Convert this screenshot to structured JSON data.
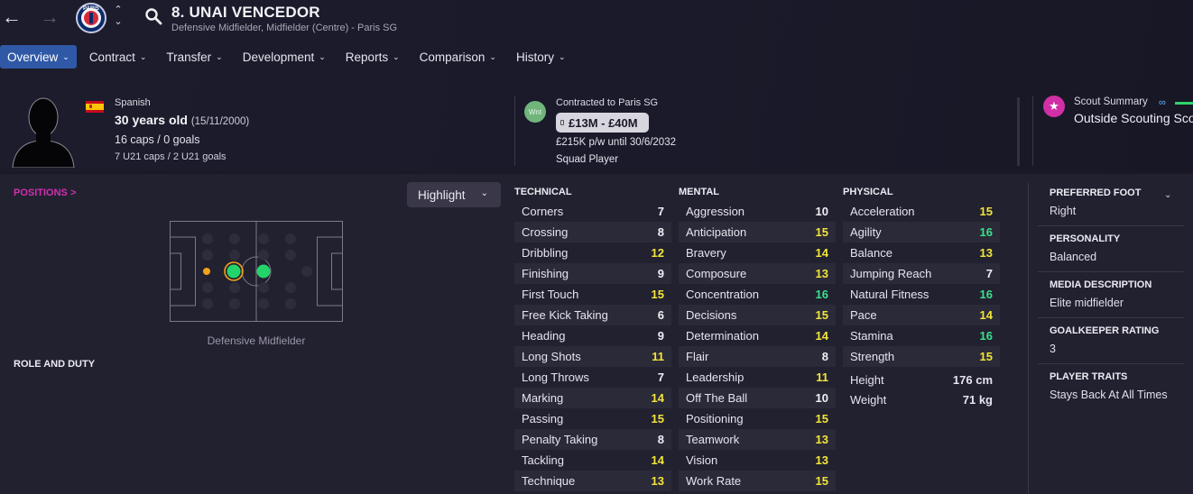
{
  "header": {
    "player_title": "8. UNAI VENCEDOR",
    "player_subtitle": "Defensive Midfielder, Midfielder (Centre) - Paris SG",
    "club_badge_text": "PARIS"
  },
  "tabs": [
    {
      "label": "Overview",
      "active": true
    },
    {
      "label": "Contract"
    },
    {
      "label": "Transfer"
    },
    {
      "label": "Development"
    },
    {
      "label": "Reports"
    },
    {
      "label": "Comparison"
    },
    {
      "label": "History"
    }
  ],
  "profile": {
    "nationality": "Spanish",
    "age": "30 years old",
    "dob": "(15/11/2000)",
    "caps": "16 caps / 0 goals",
    "u21": "7 U21 caps / 2 U21 goals"
  },
  "contract": {
    "status_badge": "Wnt",
    "label": "Contracted to Paris SG",
    "value": "£13M - £40M",
    "wage": "£215K p/w until 30/6/2032",
    "squad_status": "Squad Player"
  },
  "scout": {
    "label": "Scout Summary",
    "value": "Outside Scouting Scope"
  },
  "positions": {
    "title": "POSITIONS >",
    "highlight_label": "Highlight",
    "pitch_label": "Defensive Midfielder",
    "role_title": "ROLE AND DUTY"
  },
  "attributes": {
    "technical": {
      "title": "TECHNICAL",
      "rows": [
        {
          "name": "Corners",
          "value": "7",
          "tier": "white"
        },
        {
          "name": "Crossing",
          "value": "8",
          "tier": "white"
        },
        {
          "name": "Dribbling",
          "value": "12",
          "tier": "yellow"
        },
        {
          "name": "Finishing",
          "value": "9",
          "tier": "white"
        },
        {
          "name": "First Touch",
          "value": "15",
          "tier": "yellow"
        },
        {
          "name": "Free Kick Taking",
          "value": "6",
          "tier": "white"
        },
        {
          "name": "Heading",
          "value": "9",
          "tier": "white"
        },
        {
          "name": "Long Shots",
          "value": "11",
          "tier": "yellow"
        },
        {
          "name": "Long Throws",
          "value": "7",
          "tier": "white"
        },
        {
          "name": "Marking",
          "value": "14",
          "tier": "yellow"
        },
        {
          "name": "Passing",
          "value": "15",
          "tier": "yellow"
        },
        {
          "name": "Penalty Taking",
          "value": "8",
          "tier": "white"
        },
        {
          "name": "Tackling",
          "value": "14",
          "tier": "yellow"
        },
        {
          "name": "Technique",
          "value": "13",
          "tier": "yellow"
        }
      ]
    },
    "mental": {
      "title": "MENTAL",
      "rows": [
        {
          "name": "Aggression",
          "value": "10",
          "tier": "white"
        },
        {
          "name": "Anticipation",
          "value": "15",
          "tier": "yellow"
        },
        {
          "name": "Bravery",
          "value": "14",
          "tier": "yellow"
        },
        {
          "name": "Composure",
          "value": "13",
          "tier": "yellow"
        },
        {
          "name": "Concentration",
          "value": "16",
          "tier": "green"
        },
        {
          "name": "Decisions",
          "value": "15",
          "tier": "yellow"
        },
        {
          "name": "Determination",
          "value": "14",
          "tier": "yellow"
        },
        {
          "name": "Flair",
          "value": "8",
          "tier": "white"
        },
        {
          "name": "Leadership",
          "value": "11",
          "tier": "yellow"
        },
        {
          "name": "Off The Ball",
          "value": "10",
          "tier": "white"
        },
        {
          "name": "Positioning",
          "value": "15",
          "tier": "yellow"
        },
        {
          "name": "Teamwork",
          "value": "13",
          "tier": "yellow"
        },
        {
          "name": "Vision",
          "value": "13",
          "tier": "yellow"
        },
        {
          "name": "Work Rate",
          "value": "15",
          "tier": "yellow"
        }
      ]
    },
    "physical": {
      "title": "PHYSICAL",
      "rows": [
        {
          "name": "Acceleration",
          "value": "15",
          "tier": "yellow"
        },
        {
          "name": "Agility",
          "value": "16",
          "tier": "green"
        },
        {
          "name": "Balance",
          "value": "13",
          "tier": "yellow"
        },
        {
          "name": "Jumping Reach",
          "value": "7",
          "tier": "white"
        },
        {
          "name": "Natural Fitness",
          "value": "16",
          "tier": "green"
        },
        {
          "name": "Pace",
          "value": "14",
          "tier": "yellow"
        },
        {
          "name": "Stamina",
          "value": "16",
          "tier": "green"
        },
        {
          "name": "Strength",
          "value": "15",
          "tier": "yellow"
        }
      ],
      "height_label": "Height",
      "height_value": "176 cm",
      "weight_label": "Weight",
      "weight_value": "71 kg"
    }
  },
  "side": {
    "preferred_foot_label": "PREFERRED FOOT",
    "preferred_foot_value": "Right",
    "personality_label": "PERSONALITY",
    "personality_value": "Balanced",
    "media_label": "MEDIA DESCRIPTION",
    "media_value": "Elite midfielder",
    "gk_label": "GOALKEEPER RATING",
    "gk_value": "3",
    "traits_label": "PLAYER TRAITS",
    "traits_value": "Stays Back At All Times"
  },
  "colors": {
    "tab_active": "#2f59a6",
    "attr_white": "#f0eff4",
    "attr_yellow": "#f2e53c",
    "attr_green": "#3be08b",
    "positions_title": "#d12fb0"
  }
}
